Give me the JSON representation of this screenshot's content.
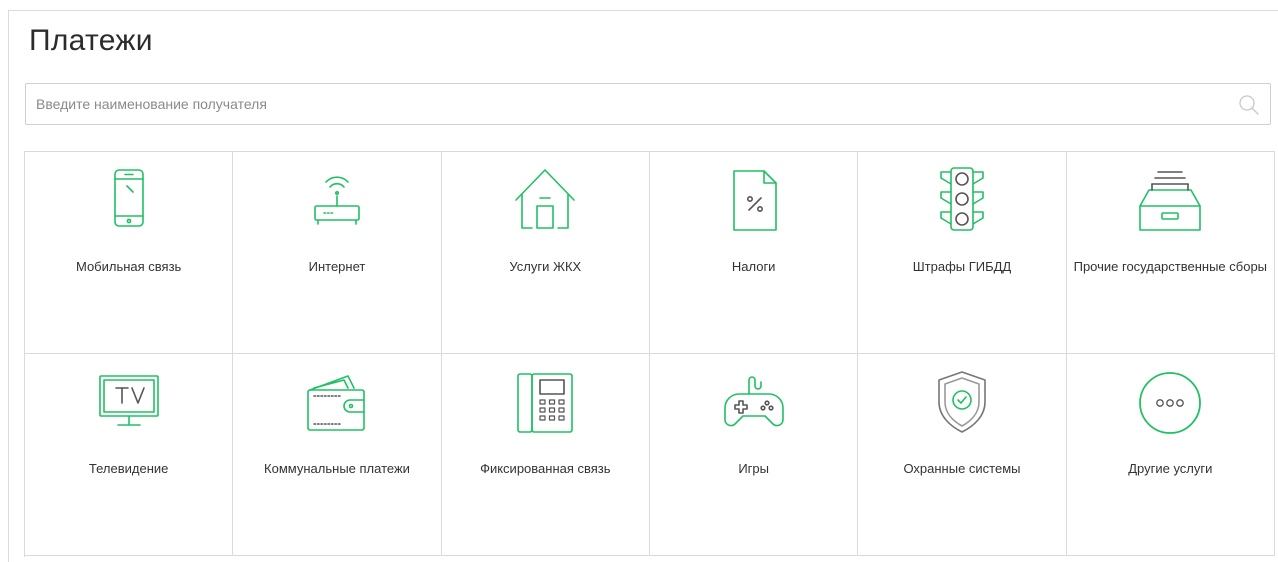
{
  "page": {
    "title": "Платежи"
  },
  "search": {
    "placeholder": "Введите наименование получателя"
  },
  "colors": {
    "accent": "#21c064",
    "border": "#dadada",
    "text": "#333333"
  },
  "tiles": [
    {
      "label": "Мобильная связь",
      "icon": "mobile-phone-icon"
    },
    {
      "label": "Интернет",
      "icon": "router-icon"
    },
    {
      "label": "Услуги ЖКХ",
      "icon": "house-icon"
    },
    {
      "label": "Налоги",
      "icon": "tax-document-icon"
    },
    {
      "label": "Штрафы ГИБДД",
      "icon": "traffic-light-icon"
    },
    {
      "label": "Прочие государственные сборы",
      "icon": "archive-tray-icon"
    },
    {
      "label": "Телевидение",
      "icon": "tv-icon"
    },
    {
      "label": "Коммунальные платежи",
      "icon": "wallet-icon"
    },
    {
      "label": "Фиксированная связь",
      "icon": "landline-phone-icon"
    },
    {
      "label": "Игры",
      "icon": "gamepad-icon"
    },
    {
      "label": "Охранные системы",
      "icon": "security-shield-icon"
    },
    {
      "label": "Другие услуги",
      "icon": "more-dots-icon"
    }
  ]
}
